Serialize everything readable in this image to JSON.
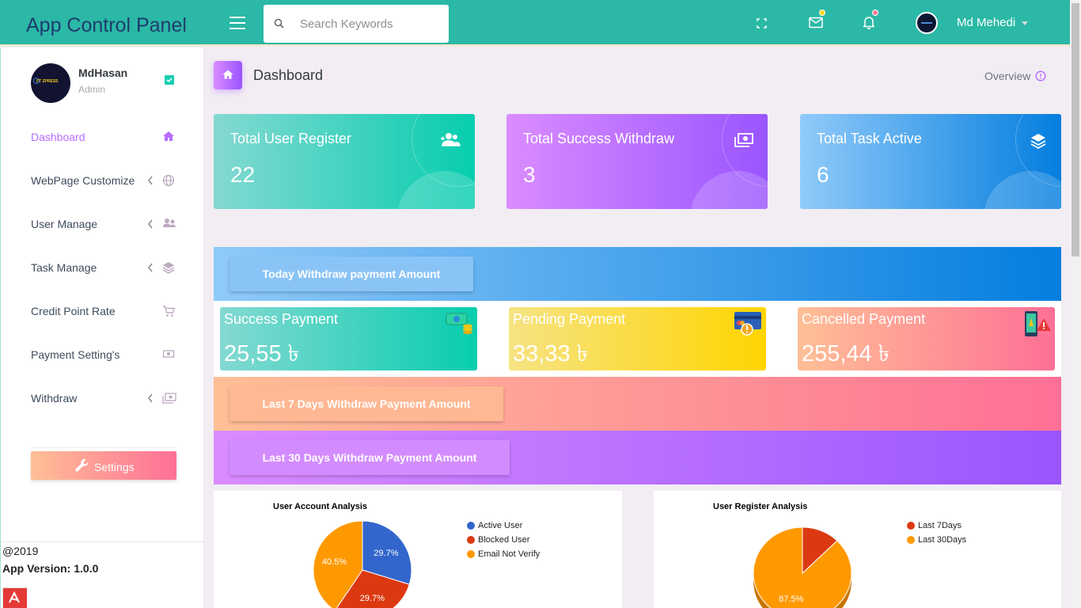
{
  "app": {
    "title": "App Control Panel"
  },
  "search": {
    "placeholder": "Search Keywords"
  },
  "user": {
    "name": "Md Mehedi"
  },
  "profile": {
    "name": "MdHasan",
    "role": "Admin",
    "logo_text": "FT ZPRESS"
  },
  "sidebar": {
    "items": [
      {
        "label": "Dashboard",
        "icon": "home-icon",
        "active": true
      },
      {
        "label": "WebPage Customize",
        "icon": "globe-icon",
        "has_submenu": true
      },
      {
        "label": "User Manage",
        "icon": "users-icon",
        "has_submenu": true
      },
      {
        "label": "Task Manage",
        "icon": "layers-icon",
        "has_submenu": true
      },
      {
        "label": "Credit Point Rate",
        "icon": "cart-icon"
      },
      {
        "label": "Payment Setting's",
        "icon": "cash-icon"
      },
      {
        "label": "Withdraw",
        "icon": "money-icon",
        "has_submenu": true
      }
    ],
    "settings_label": "Settings"
  },
  "footer": {
    "year": "@2019",
    "version": "App Version: 1.0.0"
  },
  "page": {
    "title": "Dashboard",
    "overview": "Overview"
  },
  "stats": [
    {
      "title": "Total User Register",
      "value": "22",
      "icon": "user-plus-icon"
    },
    {
      "title": "Total Success Withdraw",
      "value": "3",
      "icon": "money-icon"
    },
    {
      "title": "Total Task Active",
      "value": "6",
      "icon": "layers-icon"
    }
  ],
  "sections": {
    "today": "Today Withdraw payment Amount",
    "last7": "Last 7 Days Withdraw Payment Amount",
    "last30": "Last 30 Days Withdraw Payment Amount"
  },
  "payments": [
    {
      "title": "Success Payment",
      "value": "25,55 ৳"
    },
    {
      "title": "Pending Payment",
      "value": "33,33 ৳"
    },
    {
      "title": "Cancelled Payment",
      "value": "255,44 ৳"
    }
  ],
  "colors": {
    "topbar": "#2bb8a6",
    "accent_purple": "#b66dff",
    "pie_blue": "#3366cc",
    "pie_red": "#dc3912",
    "pie_orange": "#ff9900"
  },
  "chart_data": [
    {
      "type": "pie",
      "title": "User Account Analysis",
      "categories": [
        "Active User",
        "Blocked User",
        "Email Not Verify"
      ],
      "values": [
        29.7,
        29.7,
        40.5
      ],
      "labels": [
        "29.7%",
        "29.7%",
        "40.5%"
      ],
      "legend": "right"
    },
    {
      "type": "pie",
      "title": "User Register Analysis",
      "categories": [
        "Last 7Days",
        "Last 30Days"
      ],
      "values": [
        12.5,
        87.5
      ],
      "labels": [
        "",
        "87.5%"
      ],
      "legend": "right"
    }
  ]
}
